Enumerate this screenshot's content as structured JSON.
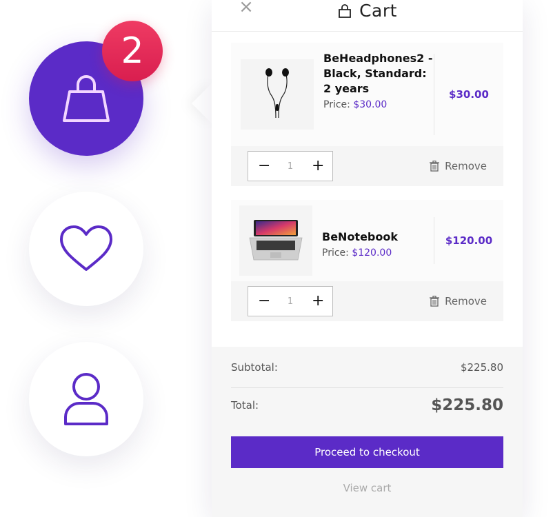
{
  "badge": {
    "count": "2"
  },
  "header": {
    "title": "Cart",
    "close_glyph": "×"
  },
  "items": [
    {
      "name": "BeHeadphones2 - Black, Standard: 2 years",
      "price_label": "Price:",
      "price": "$30.00",
      "total": "$30.00",
      "quantity": "1",
      "remove_label": "Remove",
      "thumb_icon": "earphones-image"
    },
    {
      "name": "BeNotebook",
      "price_label": "Price:",
      "price": "$120.00",
      "total": "$120.00",
      "quantity": "1",
      "remove_label": "Remove",
      "thumb_icon": "laptop-image"
    }
  ],
  "summary": {
    "subtotal_label": "Subtotal:",
    "subtotal_value": "$225.80",
    "total_label": "Total:",
    "total_value": "$225.80"
  },
  "actions": {
    "checkout_label": "Proceed to checkout",
    "view_cart_label": "View cart"
  },
  "colors": {
    "accent": "#5b2bc7",
    "badge": "#e0274f"
  },
  "icons": {
    "cart_circle": "shopping-bag-icon",
    "wishlist_circle": "heart-icon",
    "account_circle": "user-icon"
  }
}
